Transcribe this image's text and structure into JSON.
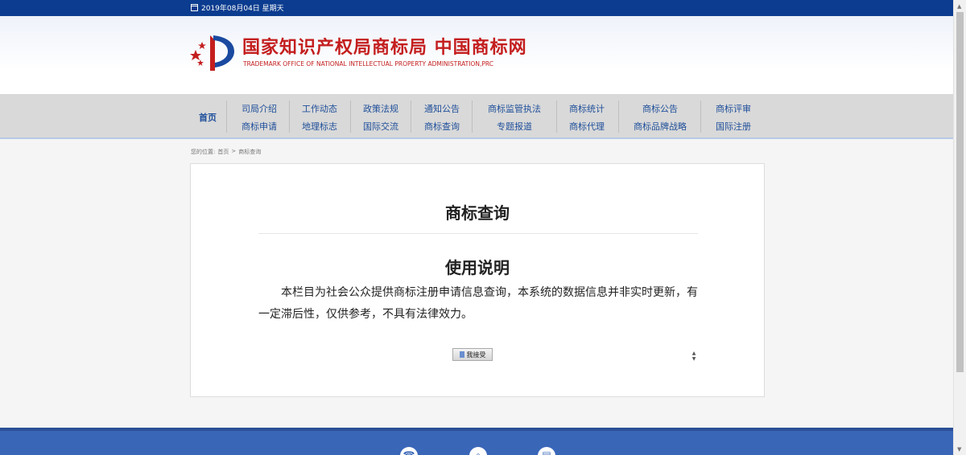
{
  "topbar": {
    "date": "2019年08月04日 星期天"
  },
  "header": {
    "title": "国家知识产权局商标局 中国商标网",
    "subtitle": "TRADEMARK OFFICE OF NATIONAL INTELLECTUAL PROPERTY ADMINISTRATION,PRC"
  },
  "nav": {
    "home": "首页",
    "cols": [
      {
        "top": "司局介绍",
        "bottom": "商标申请"
      },
      {
        "top": "工作动态",
        "bottom": "地理标志"
      },
      {
        "top": "政策法规",
        "bottom": "国际交流"
      },
      {
        "top": "通知公告",
        "bottom": "商标查询"
      },
      {
        "top": "商标监管执法",
        "bottom": "专题报道"
      },
      {
        "top": "商标统计",
        "bottom": "商标代理"
      },
      {
        "top": "商标公告",
        "bottom": "商标品牌战略"
      },
      {
        "top": "商标评审",
        "bottom": "国际注册"
      }
    ]
  },
  "breadcrumb": {
    "label": "您的位置:",
    "home": "首页",
    "sep": ">",
    "current": "商标查询"
  },
  "main": {
    "title": "商标查询",
    "usage_title": "使用说明",
    "description": "本栏目为社会公众提供商标注册申请信息查询，本系统的数据信息并非实时更新，有一定滞后性，仅供参考，不具有法律效力。",
    "accept_button": "我接受"
  },
  "footer": {
    "icons": [
      "phone-icon",
      "location-icon",
      "document-icon"
    ]
  },
  "colors": {
    "brand_blue": "#0b3c8f",
    "nav_text": "#1f4f9a",
    "title_red": "#c41e1e",
    "footer_blue": "#3a66b8"
  }
}
